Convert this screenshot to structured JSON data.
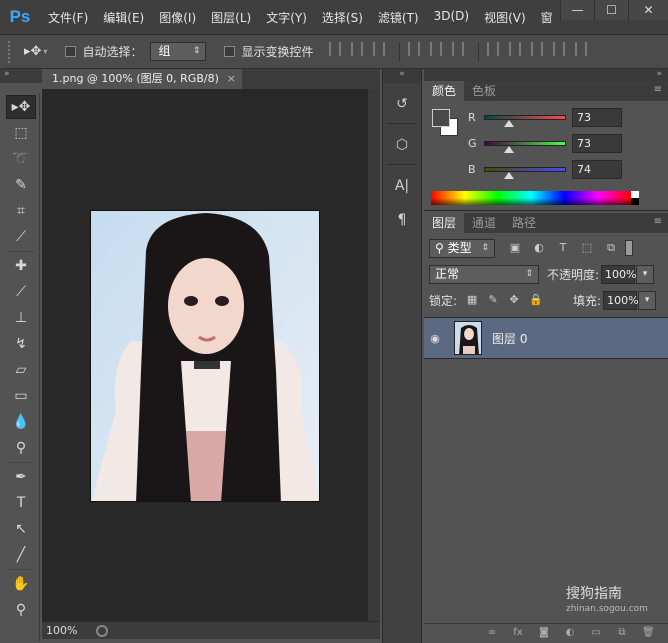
{
  "app": {
    "logo": "Ps",
    "menu": [
      "文件(F)",
      "编辑(E)",
      "图像(I)",
      "图层(L)",
      "文字(Y)",
      "选择(S)",
      "滤镜(T)",
      "3D(D)",
      "视图(V)",
      "窗"
    ],
    "window_buttons": [
      "—",
      "☐",
      "✕"
    ]
  },
  "options_bar": {
    "auto_select_label": "自动选择：",
    "auto_select_value": "组",
    "show_transform_label": "显示变换控件"
  },
  "document": {
    "tab_title": "1.png @ 100% (图层 0, RGB/8)",
    "tab_close": "×",
    "zoom": "100%"
  },
  "color_panel": {
    "tabs": [
      "颜色",
      "色板"
    ],
    "channels": [
      {
        "label": "R",
        "value": "73",
        "fraction": 0.29,
        "gradient": "linear-gradient(to right,#004949,#ff4949)"
      },
      {
        "label": "G",
        "value": "73",
        "fraction": 0.29,
        "gradient": "linear-gradient(to right,#490049,#49ff49)"
      },
      {
        "label": "B",
        "value": "74",
        "fraction": 0.29,
        "gradient": "linear-gradient(to right,#494900,#4949ff)"
      }
    ],
    "foreground": "#494949",
    "background": "#ffffff"
  },
  "layers_panel": {
    "tabs": [
      "图层",
      "通道",
      "路径"
    ],
    "filter_type": "类型",
    "blend_mode": "正常",
    "opacity_label": "不透明度:",
    "opacity_value": "100%",
    "lock_label": "锁定:",
    "fill_label": "填充:",
    "fill_value": "100%",
    "layer_name": "图层 0",
    "selected_color": "#5b6a82"
  },
  "watermark": {
    "text": "搜狗指南",
    "sub": "zhinan.sogou.com"
  }
}
